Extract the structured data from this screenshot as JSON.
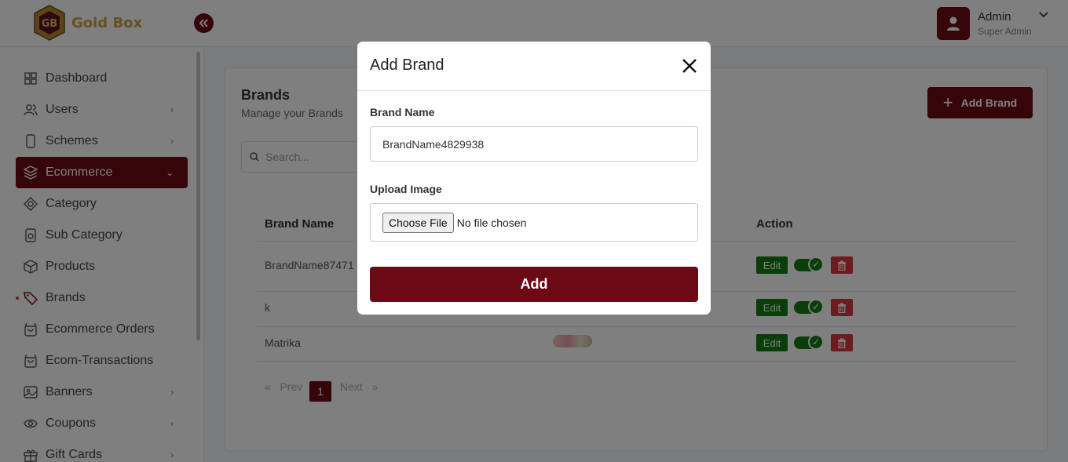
{
  "app": {
    "logo_text": "Gold Box"
  },
  "user": {
    "name": "Admin",
    "role": "Super Admin"
  },
  "sidebar": {
    "items": [
      {
        "label": "Dashboard",
        "icon": "grid-icon",
        "has_chevron": false
      },
      {
        "label": "Users",
        "icon": "users-icon",
        "has_chevron": true
      },
      {
        "label": "Schemes",
        "icon": "phone-icon",
        "has_chevron": true
      },
      {
        "label": "Ecommerce",
        "icon": "layers-icon",
        "has_chevron": true,
        "active": true
      },
      {
        "label": "Category",
        "icon": "category-icon",
        "has_chevron": false
      },
      {
        "label": "Sub Category",
        "icon": "sub-category-icon",
        "has_chevron": false
      },
      {
        "label": "Products",
        "icon": "box-icon",
        "has_chevron": false
      },
      {
        "label": "Brands",
        "icon": "tag-icon",
        "has_chevron": false
      },
      {
        "label": "Ecommerce Orders",
        "icon": "bag-icon",
        "has_chevron": false
      },
      {
        "label": "Ecom-Transactions",
        "icon": "bag-icon",
        "has_chevron": false
      },
      {
        "label": "Banners",
        "icon": "image-icon",
        "has_chevron": true
      },
      {
        "label": "Coupons",
        "icon": "eye-icon",
        "has_chevron": true
      },
      {
        "label": "Gift Cards",
        "icon": "gift-icon",
        "has_chevron": true
      }
    ]
  },
  "page": {
    "title": "Brands",
    "subtitle": "Manage your Brands",
    "add_button": "Add Brand",
    "search_placeholder": "Search..."
  },
  "table": {
    "columns": [
      "Brand Name",
      "Action"
    ],
    "rows": [
      {
        "name": "BrandName87471",
        "edit": "Edit",
        "has_image": false
      },
      {
        "name": "k",
        "edit": "Edit",
        "has_image": false
      },
      {
        "name": "Matrika",
        "edit": "Edit",
        "has_image": true
      }
    ]
  },
  "pagination": {
    "prev": "Prev",
    "current": "1",
    "next": "Next",
    "prev_arrow": "«",
    "next_arrow": "»"
  },
  "modal": {
    "title": "Add Brand",
    "brand_name_label": "Brand Name",
    "brand_name_value": "BrandName4829938",
    "upload_label": "Upload Image",
    "choose_file": "Choose File",
    "file_status": "No file chosen",
    "submit": "Add"
  },
  "colors": {
    "brand": "#6b0a14",
    "gold": "#c9a24a",
    "success": "#137a13",
    "danger": "#d9363e"
  }
}
